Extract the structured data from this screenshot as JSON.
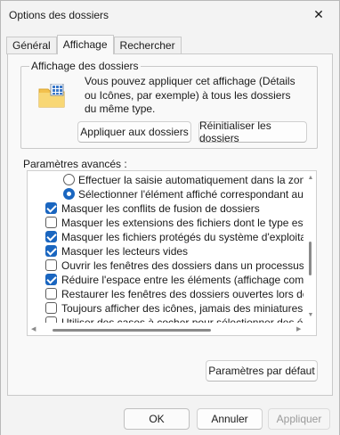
{
  "window": {
    "title": "Options des dossiers",
    "close_glyph": "✕"
  },
  "tabs": [
    {
      "label": "Général"
    },
    {
      "label": "Affichage"
    },
    {
      "label": "Rechercher"
    }
  ],
  "active_tab": "Affichage",
  "folder_views": {
    "legend": "Affichage des dossiers",
    "description": "Vous pouvez appliquer cet affichage (Détails ou Icônes, par exemple) à tous les dossiers du même type.",
    "apply_button": "Appliquer aux dossiers",
    "reset_button": "Réinitialiser les dossiers",
    "icon": "folder-grid-icon"
  },
  "advanced": {
    "label": "Paramètres avancés :",
    "items": [
      {
        "type": "radio",
        "checked": false,
        "label": "Effectuer la saisie automatiquement dans la zone Rec"
      },
      {
        "type": "radio",
        "checked": true,
        "label": "Sélectionner l'élément affiché correspondant au texte"
      },
      {
        "type": "checkbox",
        "checked": true,
        "label": "Masquer les conflits de fusion de dossiers"
      },
      {
        "type": "checkbox",
        "checked": false,
        "label": "Masquer les extensions des fichiers dont le type est conn"
      },
      {
        "type": "checkbox",
        "checked": true,
        "label": "Masquer les fichiers protégés du système d'exploitation (re"
      },
      {
        "type": "checkbox",
        "checked": true,
        "label": "Masquer les lecteurs vides"
      },
      {
        "type": "checkbox",
        "checked": false,
        "label": "Ouvrir les fenêtres des dossiers dans un processus différe"
      },
      {
        "type": "checkbox",
        "checked": true,
        "label": "Réduire l'espace entre les éléments (affichage compact)"
      },
      {
        "type": "checkbox",
        "checked": false,
        "label": "Restaurer les fenêtres des dossiers ouvertes lors de la pro"
      },
      {
        "type": "checkbox",
        "checked": false,
        "label": "Toujours afficher des icônes, jamais des miniatures"
      },
      {
        "type": "checkbox",
        "checked": false,
        "label": "Utiliser des cases à cocher pour sélectionner des élément"
      }
    ]
  },
  "buttons": {
    "defaults": "Paramètres par défaut",
    "ok": "OK",
    "cancel": "Annuler",
    "apply": "Appliquer"
  },
  "colors": {
    "accent": "#1a66c0",
    "disabled_text": "#9a9a9a"
  }
}
